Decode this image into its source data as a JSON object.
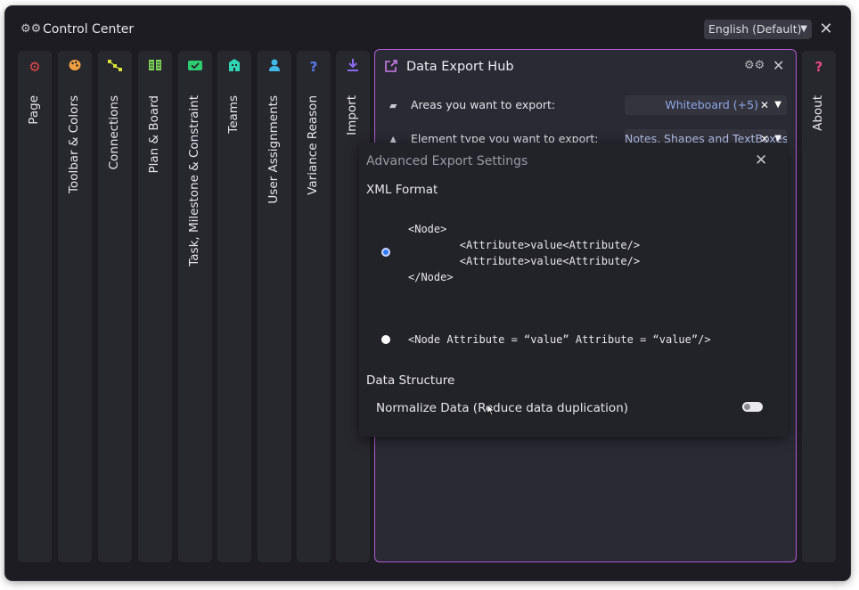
{
  "window": {
    "title": "Control Center",
    "title_icon": "gears-icon",
    "language_select": {
      "value": "English (Default)"
    },
    "close_glyph": "✕"
  },
  "tabs": [
    {
      "label": "Page",
      "icon": "gears-icon",
      "glyph": "⚙",
      "color": "#e24a4a"
    },
    {
      "label": "Toolbar & Colors",
      "icon": "palette-icon",
      "glyph": "🎨",
      "color": "#f0a040"
    },
    {
      "label": "Connections",
      "icon": "connections-icon",
      "glyph": "⋱",
      "color": "#d8e23a"
    },
    {
      "label": "Plan & Board",
      "icon": "board-icon",
      "glyph": "▥",
      "color": "#7ed957"
    },
    {
      "label": "Task, Milestone & Constraint",
      "icon": "task-icon",
      "glyph": "✔",
      "color": "#2ecc71"
    },
    {
      "label": "Teams",
      "icon": "building-icon",
      "glyph": "▦",
      "color": "#2fd5b5"
    },
    {
      "label": "User Assignments",
      "icon": "user-icon",
      "glyph": "👤",
      "color": "#41b8e6"
    },
    {
      "label": "Variance Reason",
      "icon": "question-icon",
      "glyph": "?",
      "color": "#5a7cf0"
    },
    {
      "label": "Import",
      "icon": "download-icon",
      "glyph": "⤓",
      "color": "#8b6cf0"
    }
  ],
  "hub": {
    "title": "Data Export Hub",
    "icon": "export-icon",
    "rows": [
      {
        "label": "Areas you want to export:",
        "icon": "map-icon",
        "value": "Whiteboard (+5)"
      },
      {
        "label": "Element type you want to export:",
        "icon": "shapes-icon",
        "value": "Notes, Shapes and TextBoxes (+"
      }
    ]
  },
  "about_tab": {
    "label": "About",
    "icon": "question-icon",
    "glyph": "?",
    "color": "#e84a8a"
  },
  "modal": {
    "title": "Advanced Export Settings",
    "xml_section": "XML Format",
    "option1_code": "<Node>\n        <Attribute>value<Attribute/>\n        <Attribute>value<Attribute/>\n</Node>",
    "option2_code": "<Node Attribute = “value” Attribute = “value”/>",
    "selected_option": 1,
    "data_section": "Data Structure",
    "normalize_label": "Normalize Data (Reduce data duplication)",
    "normalize_enabled": false
  }
}
